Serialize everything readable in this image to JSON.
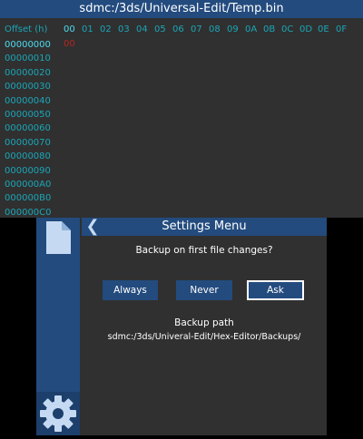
{
  "top_screen": {
    "title": "sdmc:/3ds/Universal-Edit/Temp.bin",
    "offset_header": "Offset (h)",
    "columns": [
      "00",
      "01",
      "02",
      "03",
      "04",
      "05",
      "06",
      "07",
      "08",
      "09",
      "0A",
      "0B",
      "0C",
      "0D",
      "0E",
      "0F"
    ],
    "offsets": [
      "00000000",
      "00000010",
      "00000020",
      "00000030",
      "00000040",
      "00000050",
      "00000060",
      "00000070",
      "00000080",
      "00000090",
      "000000A0",
      "000000B0",
      "000000C0"
    ],
    "first_byte": "00"
  },
  "bottom_screen": {
    "sidebar": {
      "file_icon": "file-icon",
      "settings_icon": "gear-icon"
    },
    "menu": {
      "back_icon": "chevron-left-icon",
      "back_glyph": "❮",
      "title": "Settings Menu",
      "question": "Backup on first file changes?",
      "options": {
        "always": "Always",
        "never": "Never",
        "ask": "Ask"
      },
      "selected_option": "Ask",
      "backup_path_label": "Backup path",
      "backup_path": "sdmc:/3ds/Univeral-Edit/Hex-Editor/Backups/"
    }
  },
  "colors": {
    "background": "#303030",
    "bar": "#234b7e",
    "hex_text": "#1aa6b7",
    "hex_active": "#4ddcf0",
    "cursor_byte": "#b3261e",
    "icon": "#c5daf2"
  }
}
